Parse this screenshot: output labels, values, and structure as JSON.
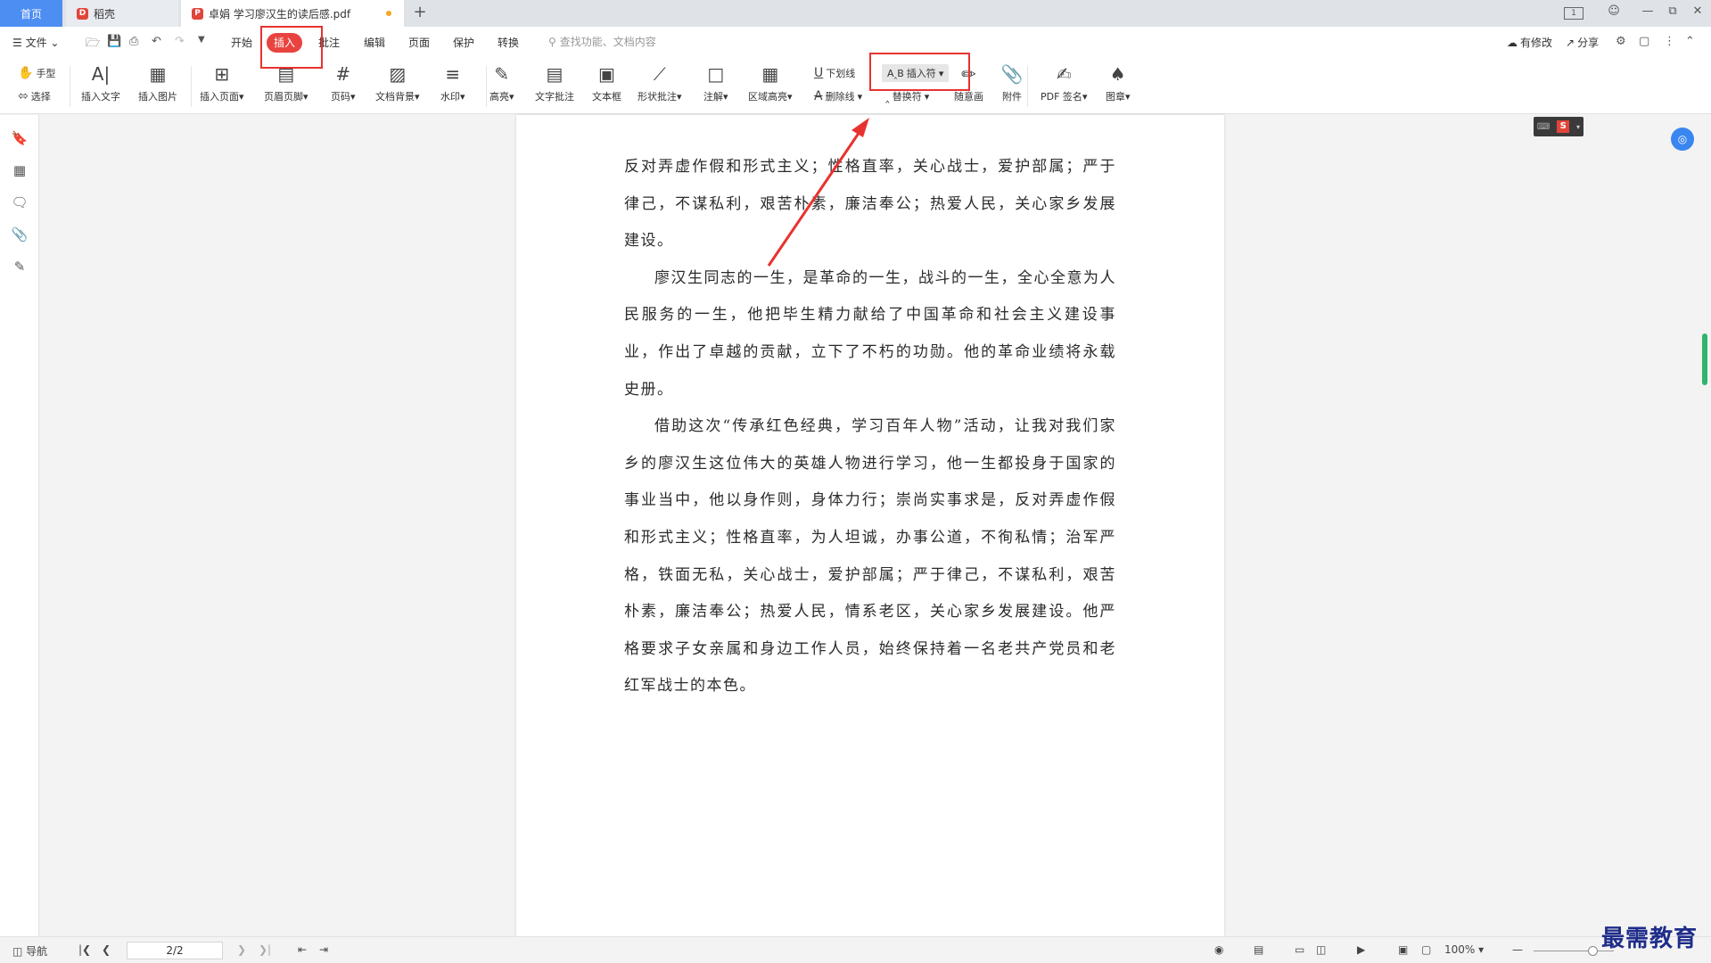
{
  "tabs": {
    "home": "首页",
    "docer": "稻壳",
    "doc": "卓娟  学习廖汉生的读后感.pdf"
  },
  "window": {
    "page_indicator": "1"
  },
  "menu": {
    "file": "文件",
    "start": "开始",
    "insert": "插入",
    "annotate": "批注",
    "edit": "编辑",
    "page": "页面",
    "protect": "保护",
    "convert": "转换",
    "search_placeholder": "查找功能、文档内容",
    "has_changes": "有修改",
    "share": "分享"
  },
  "ribbon": {
    "hand": "手型",
    "select": "选择",
    "insert_text": "插入文字",
    "insert_image": "插入图片",
    "insert_page": "插入页面",
    "header_footer": "页眉页脚",
    "page_number": "页码",
    "doc_background": "文档背景",
    "watermark": "水印",
    "highlight": "高亮",
    "text_comment": "文字批注",
    "textbox": "文本框",
    "shape_comment": "形状批注",
    "note": "注解",
    "area_highlight": "区域高亮",
    "underline": "下划线",
    "strikethrough": "删除线",
    "insert_mark": "插入符",
    "replace_mark": "替换符",
    "freehand": "随意画",
    "attachment": "附件",
    "pdf_sign": "PDF 签名",
    "stamp": "图章"
  },
  "document": {
    "paragraphs": [
      {
        "indent": false,
        "text": "反对弄虚作假和形式主义；性格直率，关心战士，爱护部属；严于律己，不谋私利，艰苦朴素，廉洁奉公；热爱人民，关心家乡发展建设。"
      },
      {
        "indent": true,
        "text": "廖汉生同志的一生，是革命的一生，战斗的一生，全心全意为人民服务的一生，他把毕生精力献给了中国革命和社会主义建设事业，作出了卓越的贡献，立下了不朽的功勋。他的革命业绩将永载史册。"
      },
      {
        "indent": true,
        "text": "借助这次“传承红色经典，学习百年人物”活动，让我对我们家乡的廖汉生这位伟大的英雄人物进行学习，他一生都投身于国家的事业当中，他以身作则，身体力行；崇尚实事求是，反对弄虚作假和形式主义；性格直率，为人坦诚，办事公道，不徇私情；治军严格，铁面无私，关心战士，爱护部属；严于律己，不谋私利，艰苦朴素，廉洁奉公；热爱人民，情系老区，关心家乡发展建设。他严格要求子女亲属和身边工作人员，始终保持着一名老共产党员和老红军战士的本色。"
      }
    ]
  },
  "statusbar": {
    "nav": "导航",
    "page_value": "2/2",
    "zoom": "100%"
  },
  "watermark_text": "最需教育"
}
